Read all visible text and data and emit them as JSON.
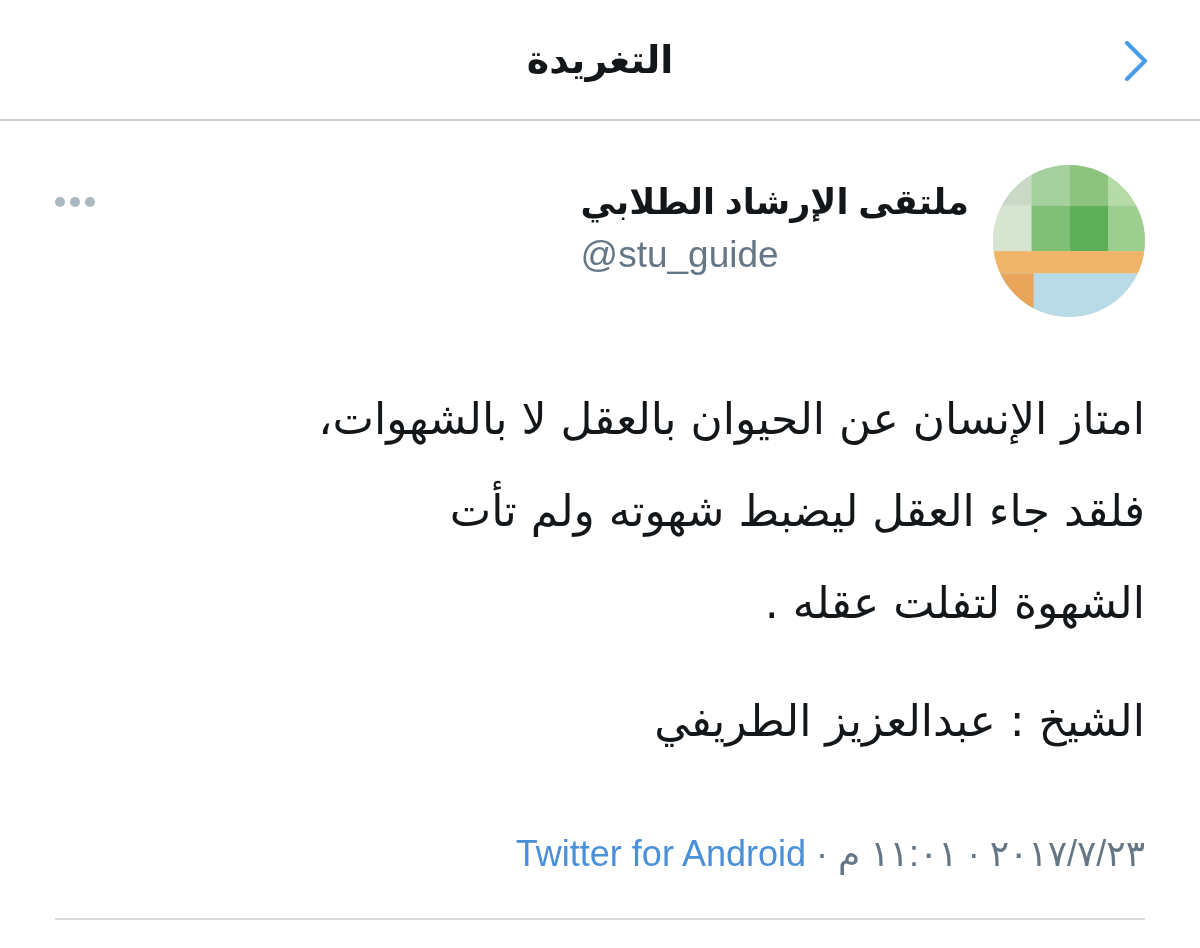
{
  "header": {
    "title": "التغريدة"
  },
  "tweet": {
    "author": {
      "name": "ملتقى الإرشاد الطلابي",
      "handle": "@stu_guide"
    },
    "paragraphs": [
      "امتاز الإنسان عن الحيوان بالعقل لا بالشهوات،\nفلقد جاء العقل ليضبط شهوته ولم تأت\nالشهوة لتفلت عقله .",
      "الشيخ : عبدالعزيز الطريفي"
    ],
    "meta": [
      {
        "kind": "text",
        "text": "٢٠١٧/٧/٢٣"
      },
      {
        "kind": "separator",
        "text": "·"
      },
      {
        "kind": "text",
        "text": "١١:٠١ م"
      },
      {
        "kind": "separator",
        "text": "·"
      },
      {
        "kind": "link",
        "text": "Twitter for Android"
      }
    ]
  }
}
